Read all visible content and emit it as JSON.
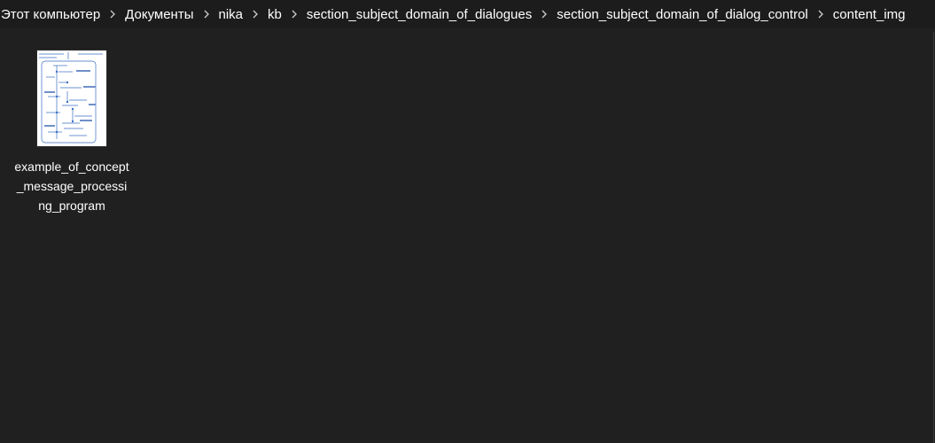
{
  "breadcrumb": {
    "items": [
      "Этот компьютер",
      "Документы",
      "nika",
      "kb",
      "section_subject_domain_of_dialogues",
      "section_subject_domain_of_dialog_control",
      "content_img"
    ],
    "separator_icon": "chevron-right-icon"
  },
  "files": [
    {
      "name": "example_of_concept_message_processing_program",
      "icon": "image-thumbnail-icon"
    }
  ],
  "colors": {
    "background": "#202020",
    "text": "#ffffff",
    "diagram_blue": "#3a6fc4"
  }
}
